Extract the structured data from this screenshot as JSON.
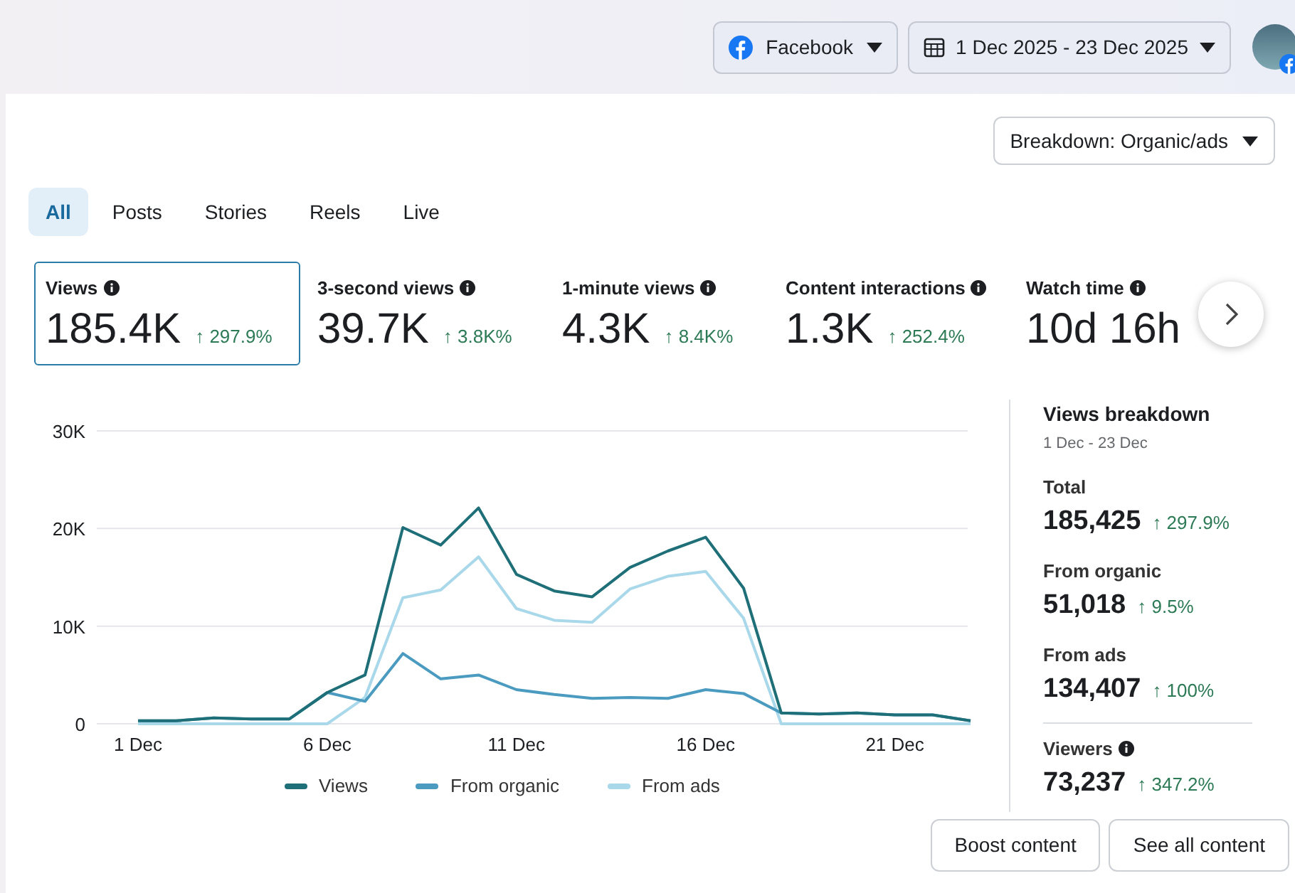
{
  "header": {
    "platform": "Facebook",
    "date_range": "1 Dec 2025 - 23 Dec 2025"
  },
  "breakdown_button": "Breakdown: Organic/ads",
  "tabs": [
    {
      "label": "All",
      "selected": true
    },
    {
      "label": "Posts",
      "selected": false
    },
    {
      "label": "Stories",
      "selected": false
    },
    {
      "label": "Reels",
      "selected": false
    },
    {
      "label": "Live",
      "selected": false
    }
  ],
  "metrics": [
    {
      "label": "Views",
      "value": "185.4K",
      "change": "↑ 297.9%",
      "selected": true
    },
    {
      "label": "3-second views",
      "value": "39.7K",
      "change": "↑ 3.8K%",
      "selected": false
    },
    {
      "label": "1-minute views",
      "value": "4.3K",
      "change": "↑ 8.4K%",
      "selected": false
    },
    {
      "label": "Content interactions",
      "value": "1.3K",
      "change": "↑ 252.4%",
      "selected": false
    },
    {
      "label": "Watch time",
      "value": "10d 16h",
      "selected": false
    }
  ],
  "chart_data": {
    "type": "line",
    "categories": [
      "1 Dec",
      null,
      null,
      null,
      null,
      "6 Dec",
      null,
      null,
      null,
      null,
      "11 Dec",
      null,
      null,
      null,
      null,
      "16 Dec",
      null,
      null,
      null,
      null,
      "21 Dec",
      null,
      null
    ],
    "yticks": [
      {
        "value": 0,
        "label": "0"
      },
      {
        "value": 10000,
        "label": "10K"
      },
      {
        "value": 20000,
        "label": "20K"
      },
      {
        "value": 30000,
        "label": "30K"
      }
    ],
    "ylim": [
      0,
      30000
    ],
    "series": [
      {
        "name": "Views",
        "color": "#1f6f78",
        "values": [
          300,
          300,
          600,
          500,
          500,
          3200,
          5000,
          20100,
          18300,
          22100,
          15300,
          13600,
          13000,
          16000,
          17700,
          19100,
          13900,
          1100,
          1000,
          1100,
          900,
          900,
          300
        ]
      },
      {
        "name": "From organic",
        "color": "#4a9bbf",
        "values": [
          300,
          300,
          600,
          500,
          500,
          3200,
          2300,
          7200,
          4600,
          5000,
          3500,
          3000,
          2600,
          2700,
          2600,
          3500,
          3100,
          1100,
          1000,
          1100,
          900,
          900,
          300
        ]
      },
      {
        "name": "From ads",
        "color": "#a8d8ea",
        "values": [
          0,
          0,
          0,
          0,
          0,
          0,
          2700,
          12900,
          13700,
          17100,
          11800,
          10600,
          10400,
          13800,
          15100,
          15600,
          10800,
          0,
          0,
          0,
          0,
          0,
          0
        ]
      }
    ]
  },
  "breakdown": {
    "title": "Views breakdown",
    "period": "1 Dec - 23 Dec",
    "items": [
      {
        "label": "Total",
        "value": "185,425",
        "change": "↑ 297.9%"
      },
      {
        "label": "From organic",
        "value": "51,018",
        "change": "↑ 9.5%"
      },
      {
        "label": "From ads",
        "value": "134,407",
        "change": "↑ 100%"
      },
      {
        "label": "Viewers",
        "value": "73,237",
        "change": "↑ 347.2%",
        "info": true
      }
    ]
  },
  "buttons": [
    "Boost content",
    "See all content"
  ]
}
